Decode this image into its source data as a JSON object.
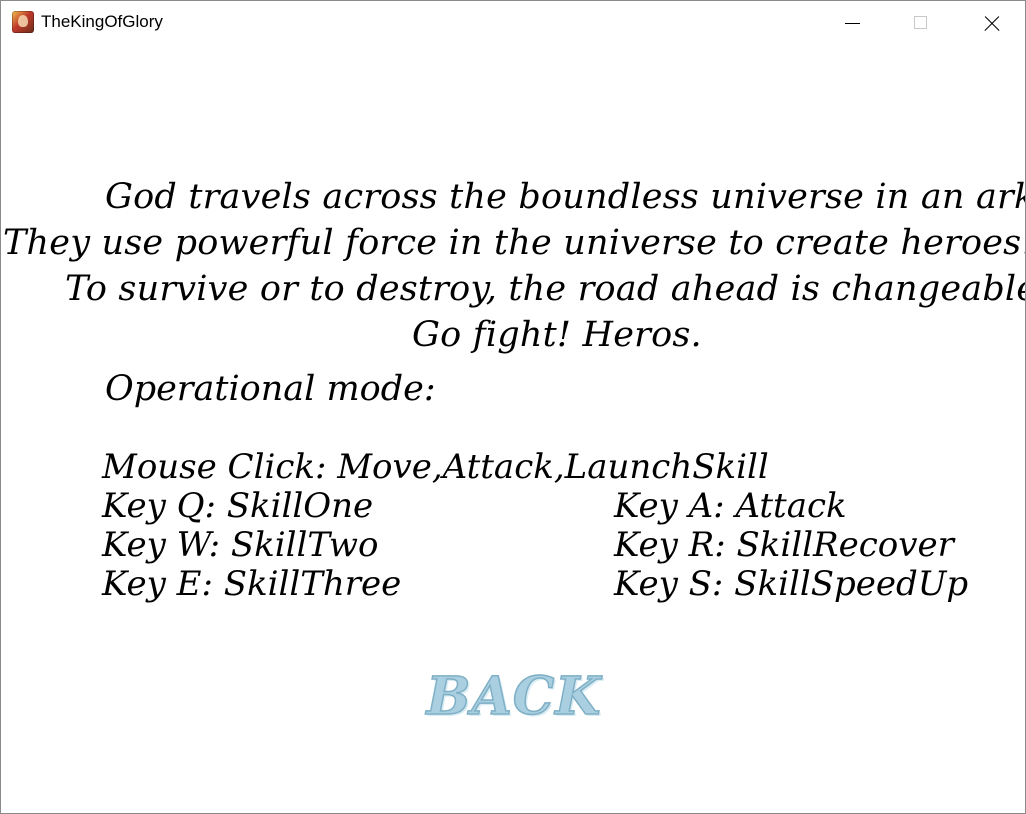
{
  "window": {
    "title": "TheKingOfGlory",
    "icon": "game-app-icon"
  },
  "story": {
    "lines": [
      "God travels across the boundless universe in an ark.",
      "They use powerful force in the universe to create heroes.",
      "To survive or to destroy, the road ahead is changeable.",
      "Go fight! Heros."
    ]
  },
  "controls": {
    "heading": "Operational mode:",
    "mouse": "Mouse Click: Move,Attack,LaunchSkill",
    "left": [
      "Key Q: SkillOne",
      "Key W: SkillTwo",
      "Key E: SkillThree"
    ],
    "right": [
      "Key A: Attack",
      "Key R: SkillRecover",
      "Key S: SkillSpeedUp"
    ]
  },
  "back_button": {
    "label": "BACK",
    "color": "#a9cfe0"
  }
}
